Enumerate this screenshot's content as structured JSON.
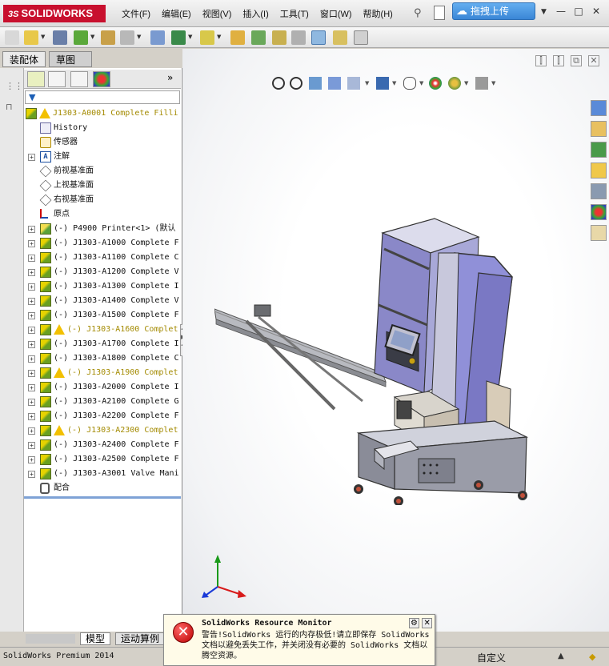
{
  "app": {
    "logo_ds": "3S",
    "logo_text": "SOLIDWORKS",
    "menu": [
      "文件(F)",
      "编辑(E)",
      "视图(V)",
      "插入(I)",
      "工具(T)",
      "窗口(W)",
      "帮助(H)"
    ],
    "upload_label": "拖拽上传",
    "window_buttons": [
      "—",
      "□",
      "✕"
    ]
  },
  "panel": {
    "tabs": [
      "装配体",
      "草图"
    ],
    "more_label": "»"
  },
  "tree": {
    "nodes": [
      {
        "label": "J1303-A0001 Complete Filli",
        "icon": "assembly-warning-icon",
        "warn": true,
        "expander": false,
        "level": 0
      },
      {
        "label": "History",
        "icon": "history-icon",
        "expander": false,
        "level": 1
      },
      {
        "label": "传感器",
        "icon": "sensor-icon",
        "expander": false,
        "level": 1
      },
      {
        "label": "注解",
        "icon": "annotation-icon",
        "expander": true,
        "level": 1
      },
      {
        "label": "前视基准面",
        "icon": "plane-icon",
        "expander": false,
        "level": 1
      },
      {
        "label": "上视基准面",
        "icon": "plane-icon",
        "expander": false,
        "level": 1
      },
      {
        "label": "右视基准面",
        "icon": "plane-icon",
        "expander": false,
        "level": 1
      },
      {
        "label": "原点",
        "icon": "origin-icon",
        "expander": false,
        "level": 1
      },
      {
        "label": "(-) P4900 Printer<1> (默认",
        "icon": "part-icon",
        "expander": true,
        "level": 1
      },
      {
        "label": "(-) J1303-A1000 Complete F",
        "icon": "assembly-icon",
        "expander": true,
        "level": 1
      },
      {
        "label": "(-) J1303-A1100 Complete C",
        "icon": "assembly-icon",
        "expander": true,
        "level": 1
      },
      {
        "label": "(-) J1303-A1200 Complete V",
        "icon": "assembly-icon",
        "expander": true,
        "level": 1
      },
      {
        "label": "(-) J1303-A1300 Complete I",
        "icon": "assembly-icon",
        "expander": true,
        "level": 1
      },
      {
        "label": "(-) J1303-A1400 Complete V",
        "icon": "assembly-icon",
        "expander": true,
        "level": 1
      },
      {
        "label": "(-) J1303-A1500 Complete F",
        "icon": "assembly-icon",
        "expander": true,
        "level": 1
      },
      {
        "label": "(-) J1303-A1600 Complet",
        "icon": "assembly-warning-icon",
        "warn": true,
        "expander": true,
        "level": 1
      },
      {
        "label": "(-) J1303-A1700 Complete I",
        "icon": "assembly-icon",
        "expander": true,
        "level": 1
      },
      {
        "label": "(-) J1303-A1800 Complete C",
        "icon": "assembly-icon",
        "expander": true,
        "level": 1
      },
      {
        "label": "(-) J1303-A1900 Complet",
        "icon": "assembly-warning-icon",
        "warn": true,
        "expander": true,
        "level": 1
      },
      {
        "label": "(-) J1303-A2000 Complete I",
        "icon": "assembly-icon",
        "expander": true,
        "level": 1
      },
      {
        "label": "(-) J1303-A2100 Complete G",
        "icon": "assembly-icon",
        "expander": true,
        "level": 1
      },
      {
        "label": "(-) J1303-A2200 Complete F",
        "icon": "assembly-icon",
        "expander": true,
        "level": 1
      },
      {
        "label": "(-) J1303-A2300 Complet",
        "icon": "assembly-warning-icon",
        "warn": true,
        "expander": true,
        "level": 1
      },
      {
        "label": "(-) J1303-A2400 Complete F",
        "icon": "assembly-icon",
        "expander": true,
        "level": 1
      },
      {
        "label": "(-) J1303-A2500 Complete F",
        "icon": "assembly-icon",
        "expander": true,
        "level": 1
      },
      {
        "label": "(-) J1303-A3001 Valve Mani",
        "icon": "assembly-icon",
        "expander": true,
        "level": 1
      },
      {
        "label": "配合",
        "icon": "mates-icon",
        "expander": false,
        "level": 1
      }
    ]
  },
  "bottom_tabs": [
    "模型",
    "运动算例"
  ],
  "status": {
    "text": "SolidWorks Premium 2014",
    "custom": "自定义"
  },
  "popup": {
    "title": "SolidWorks Resource Monitor",
    "body": "警告!SolidWorks 运行的内存极低!请立即保存 SolidWorks 文档以避免丢失工作，并关闭没有必要的 SolidWorks 文档以腾空资源。"
  },
  "colors": {
    "brand": "#c8102e",
    "upload": "#3a86d6",
    "warning": "#a38a00",
    "machine": "#8a88c8"
  }
}
